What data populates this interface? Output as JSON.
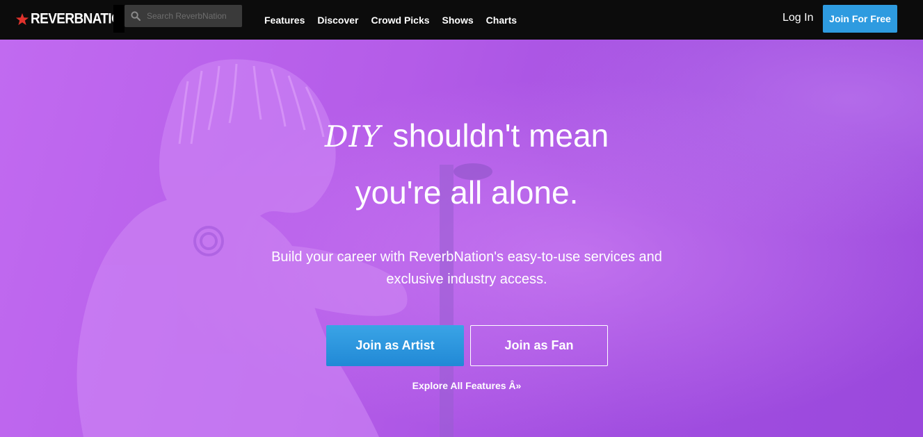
{
  "brand": {
    "name": "REVERBNATION",
    "registered_mark": "®",
    "star_color": "#e0322c"
  },
  "search": {
    "placeholder": "Search ReverbNation",
    "icon": "search-icon"
  },
  "nav": {
    "items": [
      {
        "label": "Features"
      },
      {
        "label": "Discover"
      },
      {
        "label": "Crowd Picks"
      },
      {
        "label": "Shows"
      },
      {
        "label": "Charts"
      }
    ]
  },
  "account": {
    "login_label": "Log In",
    "join_label": "Join For Free"
  },
  "hero": {
    "headline_accent": "DIY",
    "headline_line1_rest": "shouldn't mean",
    "headline_line2": "you're all alone.",
    "subtitle": "Build your career with ReverbNation's easy-to-use services and exclusive industry access.",
    "artist_button_label": "Join as Artist",
    "fan_button_label": "Join as Fan",
    "explore_label": "Explore All Features Â»"
  },
  "colors": {
    "topbar": "#0c0c0c",
    "accent_blue": "#2e9be0",
    "hero_purple": "#b45ce8"
  }
}
